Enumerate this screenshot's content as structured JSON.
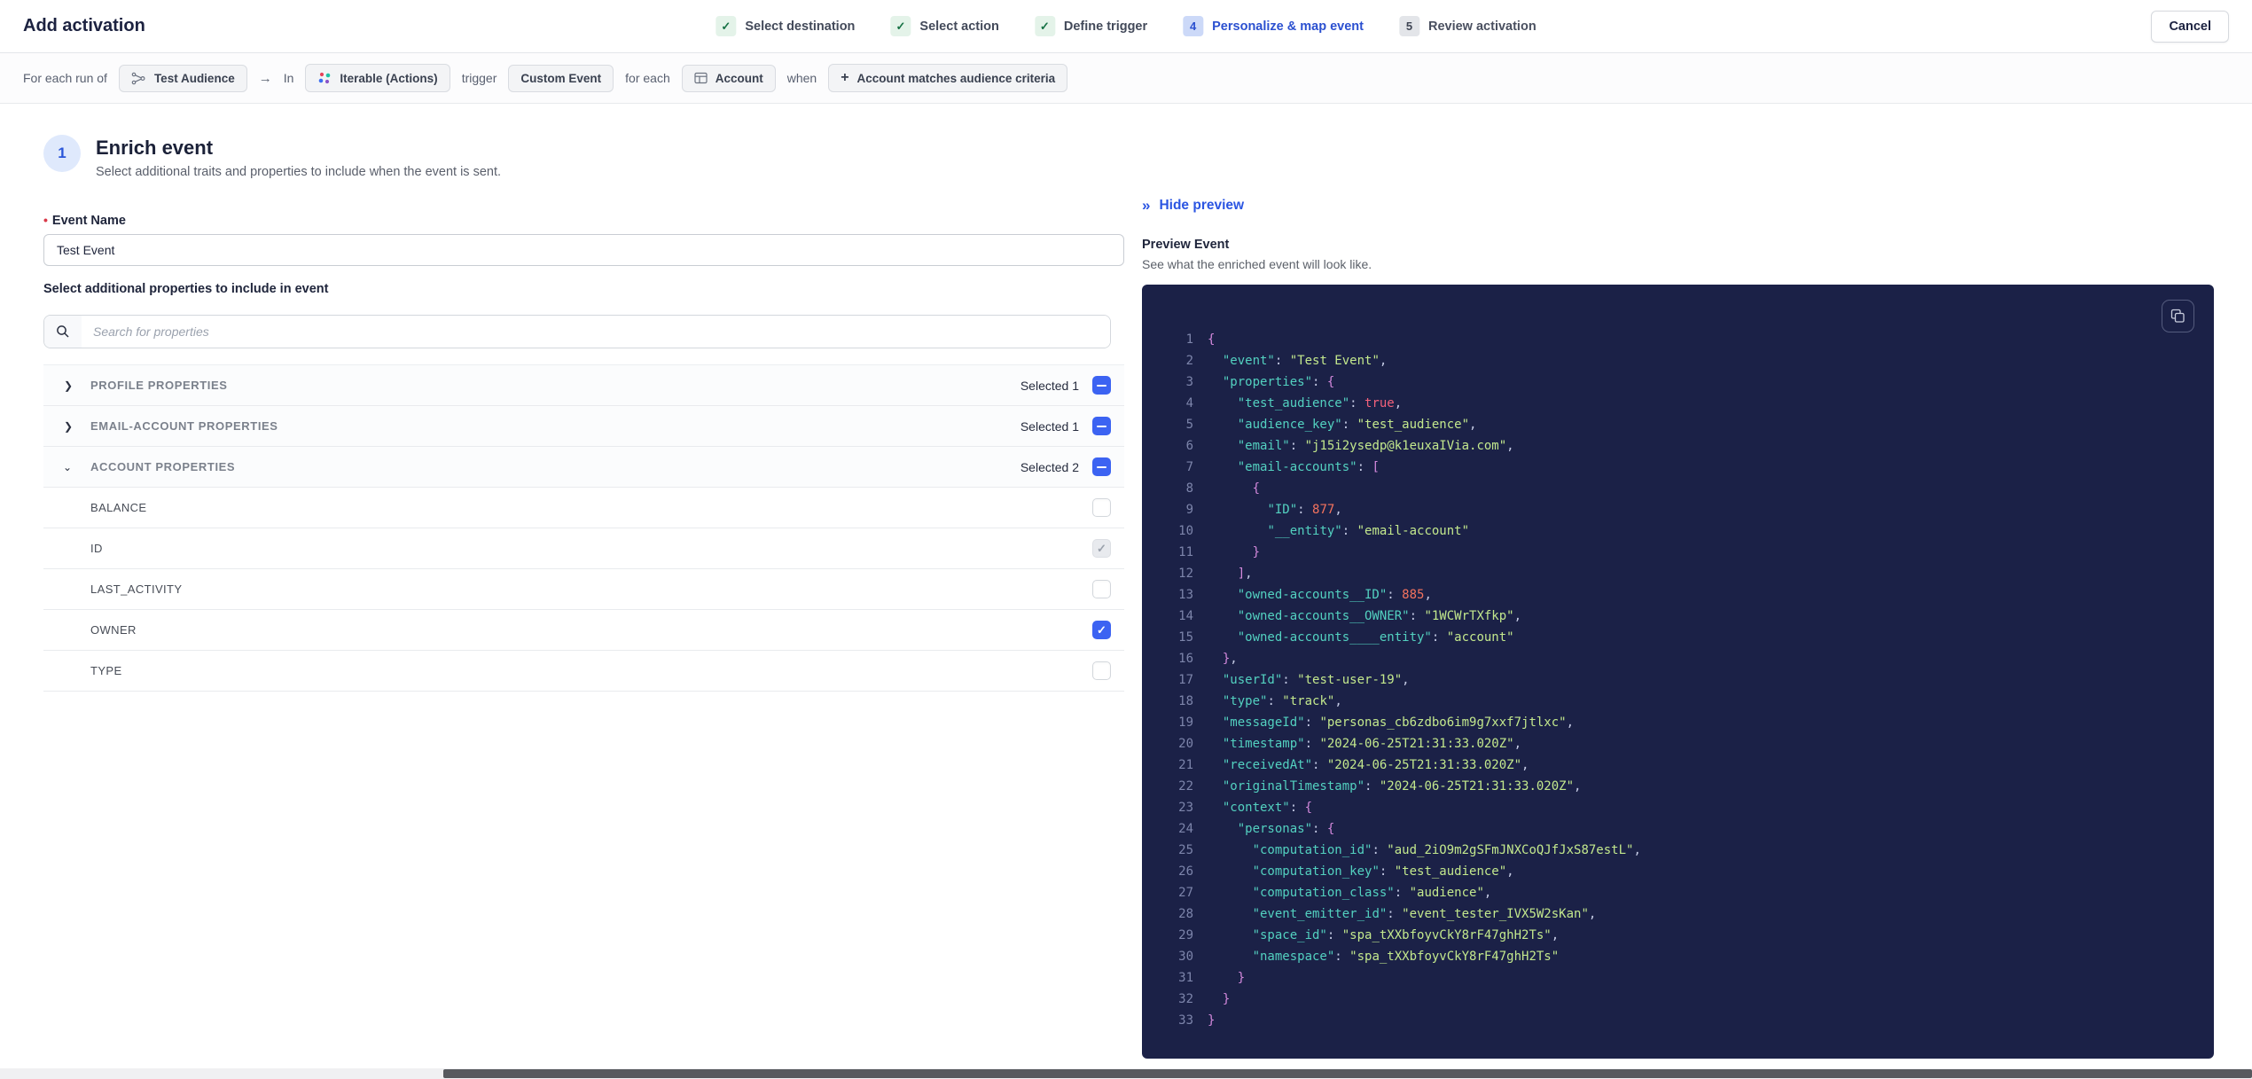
{
  "header": {
    "title": "Add activation",
    "cancel_label": "Cancel",
    "steps": [
      {
        "badge": "✓",
        "label": "Select destination",
        "status": "done"
      },
      {
        "badge": "✓",
        "label": "Select action",
        "status": "done"
      },
      {
        "badge": "✓",
        "label": "Define trigger",
        "status": "done"
      },
      {
        "badge": "4",
        "label": "Personalize & map event",
        "status": "current"
      },
      {
        "badge": "5",
        "label": "Review activation",
        "status": "upcoming"
      }
    ]
  },
  "context_bar": {
    "prefix": "For each run of",
    "audience_chip": "Test Audience",
    "arrow": "→",
    "in_word": "In",
    "destination_chip": "Iterable (Actions)",
    "trigger_word": "trigger",
    "trigger_chip": "Custom Event",
    "for_each_word": "for each",
    "entity_chip": "Account",
    "when_word": "when",
    "plus": "+",
    "criteria_chip": "Account matches audience criteria"
  },
  "enrich": {
    "step_number": "1",
    "title": "Enrich event",
    "subtitle": "Select additional traits and properties to include when the event is sent.",
    "event_name_label": "Event Name",
    "required_marker": "•",
    "event_name_value": "Test Event",
    "properties_label": "Select additional properties to include in event",
    "search_placeholder": "Search for properties"
  },
  "property_groups": [
    {
      "label": "PROFILE PROPERTIES",
      "selected_text": "Selected 1",
      "expanded": false
    },
    {
      "label": "EMAIL-ACCOUNT PROPERTIES",
      "selected_text": "Selected 1",
      "expanded": false
    },
    {
      "label": "ACCOUNT PROPERTIES",
      "selected_text": "Selected 2",
      "expanded": true
    }
  ],
  "account_properties": [
    {
      "label": "BALANCE",
      "state": "unchecked"
    },
    {
      "label": "ID",
      "state": "checked-disabled"
    },
    {
      "label": "LAST_ACTIVITY",
      "state": "unchecked"
    },
    {
      "label": "OWNER",
      "state": "checked"
    },
    {
      "label": "TYPE",
      "state": "unchecked"
    }
  ],
  "icons": {
    "chevron_collapsed": "❯",
    "chevron_expanded": "⌄",
    "check": "✓",
    "hide_preview_chevrons": "»"
  },
  "preview": {
    "hide_label": "Hide preview",
    "title": "Preview Event",
    "subtitle": "See what the enriched event will look like."
  },
  "colors": {
    "accent_blue": "#2b55e2",
    "checkbox_blue": "#3c63f2",
    "step_done_green": "#177245",
    "code_bg": "#1b2147",
    "code_key": "#53d1c0",
    "code_string": "#c3e88d",
    "code_number": "#f4735e",
    "code_boolean": "#f3617b",
    "code_brace": "#d489dd",
    "iterable_logo": [
      "#e8435a",
      "#3d6ef2",
      "#1fc2a7",
      "#8a55c9"
    ]
  },
  "code": {
    "lines": [
      {
        "n": 1,
        "t": [
          [
            "p",
            "{"
          ]
        ]
      },
      {
        "n": 2,
        "t": [
          [
            "w",
            "  "
          ],
          [
            "k",
            "\"event\""
          ],
          [
            "o",
            ": "
          ],
          [
            "s",
            "\"Test Event\""
          ],
          [
            "o",
            ","
          ]
        ]
      },
      {
        "n": 3,
        "t": [
          [
            "w",
            "  "
          ],
          [
            "k",
            "\"properties\""
          ],
          [
            "o",
            ": "
          ],
          [
            "p",
            "{"
          ]
        ]
      },
      {
        "n": 4,
        "t": [
          [
            "w",
            "    "
          ],
          [
            "k",
            "\"test_audience\""
          ],
          [
            "o",
            ": "
          ],
          [
            "b",
            "true"
          ],
          [
            "o",
            ","
          ]
        ]
      },
      {
        "n": 5,
        "t": [
          [
            "w",
            "    "
          ],
          [
            "k",
            "\"audience_key\""
          ],
          [
            "o",
            ": "
          ],
          [
            "s",
            "\"test_audience\""
          ],
          [
            "o",
            ","
          ]
        ]
      },
      {
        "n": 6,
        "t": [
          [
            "w",
            "    "
          ],
          [
            "k",
            "\"email\""
          ],
          [
            "o",
            ": "
          ],
          [
            "s",
            "\"j15i2ysedp@k1euxaIVia.com\""
          ],
          [
            "o",
            ","
          ]
        ]
      },
      {
        "n": 7,
        "t": [
          [
            "w",
            "    "
          ],
          [
            "k",
            "\"email-accounts\""
          ],
          [
            "o",
            ": "
          ],
          [
            "p",
            "["
          ]
        ]
      },
      {
        "n": 8,
        "t": [
          [
            "w",
            "      "
          ],
          [
            "p",
            "{"
          ]
        ]
      },
      {
        "n": 9,
        "t": [
          [
            "w",
            "        "
          ],
          [
            "k",
            "\"ID\""
          ],
          [
            "o",
            ": "
          ],
          [
            "n",
            "877"
          ],
          [
            "o",
            ","
          ]
        ]
      },
      {
        "n": 10,
        "t": [
          [
            "w",
            "        "
          ],
          [
            "k",
            "\"__entity\""
          ],
          [
            "o",
            ": "
          ],
          [
            "s",
            "\"email-account\""
          ]
        ]
      },
      {
        "n": 11,
        "t": [
          [
            "w",
            "      "
          ],
          [
            "p",
            "}"
          ]
        ]
      },
      {
        "n": 12,
        "t": [
          [
            "w",
            "    "
          ],
          [
            "p",
            "]"
          ],
          [
            "o",
            ","
          ]
        ]
      },
      {
        "n": 13,
        "t": [
          [
            "w",
            "    "
          ],
          [
            "k",
            "\"owned-accounts__ID\""
          ],
          [
            "o",
            ": "
          ],
          [
            "n",
            "885"
          ],
          [
            "o",
            ","
          ]
        ]
      },
      {
        "n": 14,
        "t": [
          [
            "w",
            "    "
          ],
          [
            "k",
            "\"owned-accounts__OWNER\""
          ],
          [
            "o",
            ": "
          ],
          [
            "s",
            "\"1WCWrTXfkp\""
          ],
          [
            "o",
            ","
          ]
        ]
      },
      {
        "n": 15,
        "t": [
          [
            "w",
            "    "
          ],
          [
            "k",
            "\"owned-accounts____entity\""
          ],
          [
            "o",
            ": "
          ],
          [
            "s",
            "\"account\""
          ]
        ]
      },
      {
        "n": 16,
        "t": [
          [
            "w",
            "  "
          ],
          [
            "p",
            "}"
          ],
          [
            "o",
            ","
          ]
        ]
      },
      {
        "n": 17,
        "t": [
          [
            "w",
            "  "
          ],
          [
            "k",
            "\"userId\""
          ],
          [
            "o",
            ": "
          ],
          [
            "s",
            "\"test-user-19\""
          ],
          [
            "o",
            ","
          ]
        ]
      },
      {
        "n": 18,
        "t": [
          [
            "w",
            "  "
          ],
          [
            "k",
            "\"type\""
          ],
          [
            "o",
            ": "
          ],
          [
            "s",
            "\"track\""
          ],
          [
            "o",
            ","
          ]
        ]
      },
      {
        "n": 19,
        "t": [
          [
            "w",
            "  "
          ],
          [
            "k",
            "\"messageId\""
          ],
          [
            "o",
            ": "
          ],
          [
            "s",
            "\"personas_cb6zdbo6im9g7xxf7jtlxc\""
          ],
          [
            "o",
            ","
          ]
        ]
      },
      {
        "n": 20,
        "t": [
          [
            "w",
            "  "
          ],
          [
            "k",
            "\"timestamp\""
          ],
          [
            "o",
            ": "
          ],
          [
            "s",
            "\"2024-06-25T21:31:33.020Z\""
          ],
          [
            "o",
            ","
          ]
        ]
      },
      {
        "n": 21,
        "t": [
          [
            "w",
            "  "
          ],
          [
            "k",
            "\"receivedAt\""
          ],
          [
            "o",
            ": "
          ],
          [
            "s",
            "\"2024-06-25T21:31:33.020Z\""
          ],
          [
            "o",
            ","
          ]
        ]
      },
      {
        "n": 22,
        "t": [
          [
            "w",
            "  "
          ],
          [
            "k",
            "\"originalTimestamp\""
          ],
          [
            "o",
            ": "
          ],
          [
            "s",
            "\"2024-06-25T21:31:33.020Z\""
          ],
          [
            "o",
            ","
          ]
        ]
      },
      {
        "n": 23,
        "t": [
          [
            "w",
            "  "
          ],
          [
            "k",
            "\"context\""
          ],
          [
            "o",
            ": "
          ],
          [
            "p",
            "{"
          ]
        ]
      },
      {
        "n": 24,
        "t": [
          [
            "w",
            "    "
          ],
          [
            "k",
            "\"personas\""
          ],
          [
            "o",
            ": "
          ],
          [
            "p",
            "{"
          ]
        ]
      },
      {
        "n": 25,
        "t": [
          [
            "w",
            "      "
          ],
          [
            "k",
            "\"computation_id\""
          ],
          [
            "o",
            ": "
          ],
          [
            "s",
            "\"aud_2iO9m2gSFmJNXCoQJfJxS87estL\""
          ],
          [
            "o",
            ","
          ]
        ]
      },
      {
        "n": 26,
        "t": [
          [
            "w",
            "      "
          ],
          [
            "k",
            "\"computation_key\""
          ],
          [
            "o",
            ": "
          ],
          [
            "s",
            "\"test_audience\""
          ],
          [
            "o",
            ","
          ]
        ]
      },
      {
        "n": 27,
        "t": [
          [
            "w",
            "      "
          ],
          [
            "k",
            "\"computation_class\""
          ],
          [
            "o",
            ": "
          ],
          [
            "s",
            "\"audience\""
          ],
          [
            "o",
            ","
          ]
        ]
      },
      {
        "n": 28,
        "t": [
          [
            "w",
            "      "
          ],
          [
            "k",
            "\"event_emitter_id\""
          ],
          [
            "o",
            ": "
          ],
          [
            "s",
            "\"event_tester_IVX5W2sKan\""
          ],
          [
            "o",
            ","
          ]
        ]
      },
      {
        "n": 29,
        "t": [
          [
            "w",
            "      "
          ],
          [
            "k",
            "\"space_id\""
          ],
          [
            "o",
            ": "
          ],
          [
            "s",
            "\"spa_tXXbfoyvCkY8rF47ghH2Ts\""
          ],
          [
            "o",
            ","
          ]
        ]
      },
      {
        "n": 30,
        "t": [
          [
            "w",
            "      "
          ],
          [
            "k",
            "\"namespace\""
          ],
          [
            "o",
            ": "
          ],
          [
            "s",
            "\"spa_tXXbfoyvCkY8rF47ghH2Ts\""
          ]
        ]
      },
      {
        "n": 31,
        "t": [
          [
            "w",
            "    "
          ],
          [
            "p",
            "}"
          ]
        ]
      },
      {
        "n": 32,
        "t": [
          [
            "w",
            "  "
          ],
          [
            "p",
            "}"
          ]
        ]
      },
      {
        "n": 33,
        "t": [
          [
            "p",
            "}"
          ]
        ]
      }
    ]
  }
}
